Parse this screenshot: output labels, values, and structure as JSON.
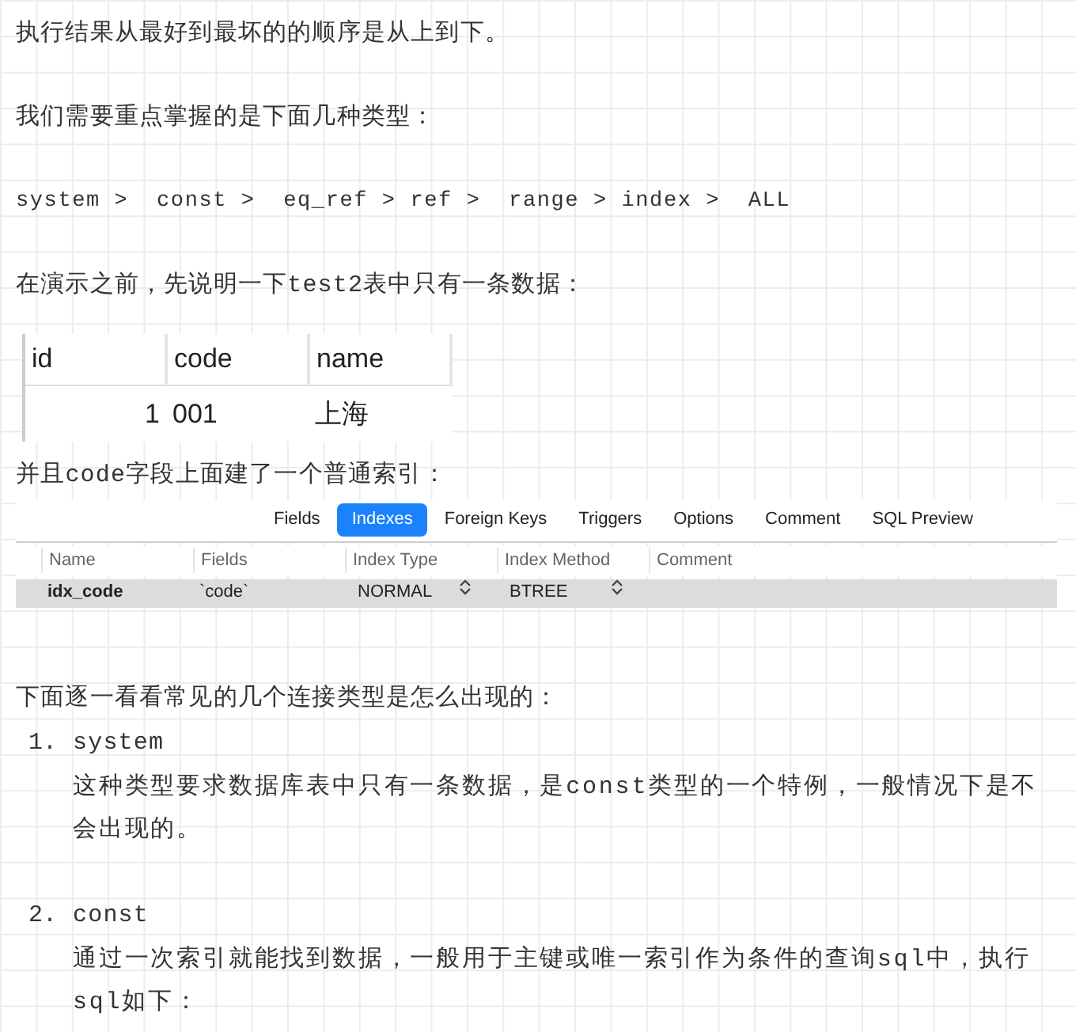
{
  "intro": [
    "执行结果从最好到最坏的的顺序是从上到下。",
    "我们需要重点掌握的是下面几种类型："
  ],
  "type_order": "system >  const >  eq_ref > ref >  range > index >  ALL",
  "before_demo": "在演示之前，先说明一下test2表中只有一条数据：",
  "data_table": {
    "columns": [
      "id",
      "code",
      "name"
    ],
    "rows": [
      [
        "1",
        "001",
        "上海"
      ]
    ]
  },
  "index_note": "并且code字段上面建了一个普通索引：",
  "index_editor": {
    "tabs": [
      {
        "label": "Fields",
        "selected": false
      },
      {
        "label": "Indexes",
        "selected": true
      },
      {
        "label": "Foreign Keys",
        "selected": false
      },
      {
        "label": "Triggers",
        "selected": false
      },
      {
        "label": "Options",
        "selected": false
      },
      {
        "label": "Comment",
        "selected": false
      },
      {
        "label": "SQL Preview",
        "selected": false
      }
    ],
    "columns": [
      "Name",
      "Fields",
      "Index Type",
      "Index Method",
      "Comment"
    ],
    "rows": [
      {
        "name": "idx_code",
        "fields": "`code`",
        "index_type": "NORMAL",
        "index_method": "BTREE",
        "selected": true
      }
    ]
  },
  "list_intro": "下面逐一看看常见的几个连接类型是怎么出现的：",
  "join_types": [
    {
      "number": "1.",
      "title": "system",
      "description": "这种类型要求数据库表中只有一条数据，是const类型的一个特例，一般情况下是不会出现的。"
    },
    {
      "number": "2.",
      "title": "const",
      "description": "通过一次索引就能找到数据，一般用于主键或唯一索引作为条件的查询sql中，执行sql如下："
    }
  ]
}
